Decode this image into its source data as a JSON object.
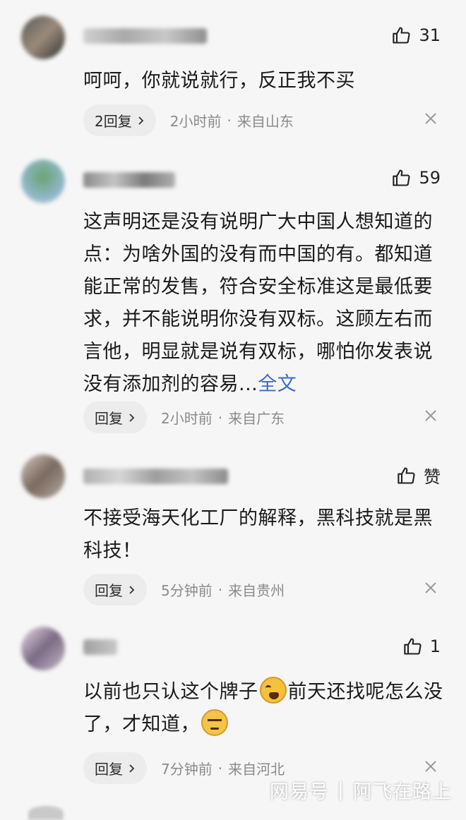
{
  "comments": [
    {
      "likes": "31",
      "text": "呵呵，你就说就行，反正我不买",
      "more": "",
      "reply": "2回复",
      "time": "2小时前",
      "location": "来自山东"
    },
    {
      "likes": "59",
      "text": "这声明还是没有说明广大中国人想知道的点：为啥外国的没有而中国的有。都知道能正常的发售，符合安全标准这是最低要求，并不能说明你没有双标。这顾左右而言他，明显就是说有双标，哪怕你发表说没有添加剂的容易...",
      "more": "全文",
      "reply": "回复",
      "time": "2小时前",
      "location": "来自广东"
    },
    {
      "likes": "赞",
      "text": "不接受海天化工厂的解释，黑科技就是黑科技！",
      "more": "",
      "reply": "回复",
      "time": "5分钟前",
      "location": "来自贵州"
    },
    {
      "likes": "1",
      "text_a": "以前也只认这个牌子",
      "text_b": "前天还找呢怎么没了，才知道，",
      "reply": "回复",
      "time": "7分钟前",
      "location": "来自河北"
    }
  ],
  "meta_separator": "·",
  "watermark": {
    "brand": "网易号",
    "separator": "|",
    "author": "阿飞在路上"
  },
  "colors": {
    "background": "#f6f6f6",
    "link": "#3b6cc1",
    "meta": "#8a8a8a"
  },
  "icons": {
    "like": "thumbs-up-icon",
    "chevron": "chevron-right-icon",
    "close": "close-icon",
    "emoji_1": "crying-laughing-emoji",
    "emoji_2": "annoyed-face-emoji"
  }
}
